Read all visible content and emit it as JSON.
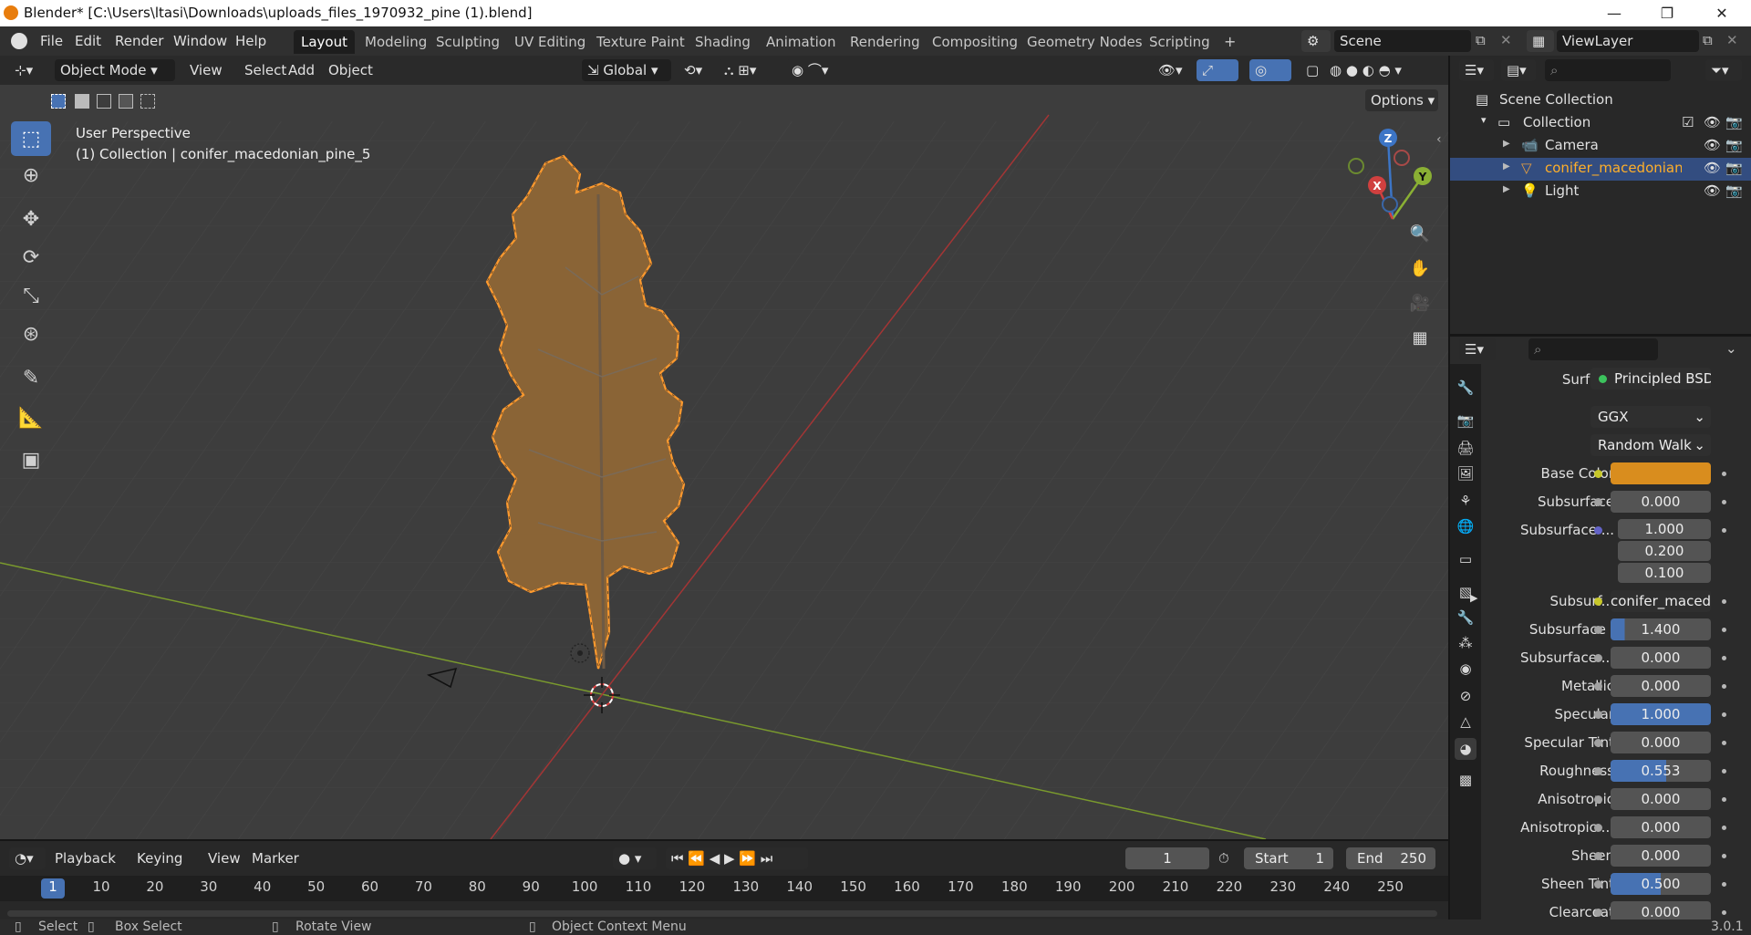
{
  "window": {
    "title": "Blender* [C:\\Users\\ltasi\\Downloads\\uploads_files_1970932_pine (1).blend]",
    "minimize": "—",
    "maximize": "❐",
    "close": "✕"
  },
  "menu": [
    "File",
    "Edit",
    "Render",
    "Window",
    "Help"
  ],
  "workspaces": [
    "Layout",
    "Modeling",
    "Sculpting",
    "UV Editing",
    "Texture Paint",
    "Shading",
    "Animation",
    "Rendering",
    "Compositing",
    "Geometry Nodes",
    "Scripting"
  ],
  "active_workspace": "Layout",
  "scene_name": "Scene",
  "view_layer": "ViewLayer",
  "viewport_header": {
    "mode": "Object Mode",
    "menus": [
      "View",
      "Select",
      "Add",
      "Object"
    ],
    "orientation": "Global",
    "options_label": "Options"
  },
  "viewport": {
    "perspective_label": "User Perspective",
    "collection_label": "(1) Collection | conifer_macedonian_pine_5",
    "gizmo": {
      "x": "X",
      "y": "Y",
      "z": "Z"
    }
  },
  "outliner": {
    "root": "Scene Collection",
    "collection": "Collection",
    "items": [
      {
        "name": "Camera",
        "selected": false
      },
      {
        "name": "conifer_macedonian_p",
        "selected": true
      },
      {
        "name": "Light",
        "selected": false
      }
    ]
  },
  "properties": {
    "surface_label": "Surface",
    "surface_value": "Principled BSDF",
    "distribution": "GGX",
    "subsurface_method": "Random Walk",
    "rows": [
      {
        "label": "Base Color",
        "value": "",
        "socket": "#c7c729",
        "kind": "color",
        "color": "#d98d1e"
      },
      {
        "label": "Subsurface",
        "value": "0.000",
        "socket": "#a1a1a1",
        "kind": "num",
        "fill": 0
      },
      {
        "label": "Subsurface ...",
        "value": "1.000",
        "socket": "#6363c7",
        "kind": "vec"
      },
      {
        "label": "",
        "value": "0.200",
        "socket": "",
        "kind": "vec2"
      },
      {
        "label": "",
        "value": "0.100",
        "socket": "",
        "kind": "vec2"
      },
      {
        "label": "Subsurf...",
        "value": "conifer_maced...",
        "socket": "#c7c729",
        "kind": "link"
      },
      {
        "label": "Subsurface I",
        "value": "1.400",
        "socket": "#a1a1a1",
        "kind": "num",
        "fill": 0.14
      },
      {
        "label": "Subsurface ...",
        "value": "0.000",
        "socket": "#a1a1a1",
        "kind": "num",
        "fill": 0
      },
      {
        "label": "Metallic",
        "value": "0.000",
        "socket": "#a1a1a1",
        "kind": "num",
        "fill": 0
      },
      {
        "label": "Specular",
        "value": "1.000",
        "socket": "#a1a1a1",
        "kind": "num",
        "fill": 1
      },
      {
        "label": "Specular Tint",
        "value": "0.000",
        "socket": "#a1a1a1",
        "kind": "num",
        "fill": 0
      },
      {
        "label": "Roughness",
        "value": "0.553",
        "socket": "#a1a1a1",
        "kind": "num",
        "fill": 0.553
      },
      {
        "label": "Anisotropic",
        "value": "0.000",
        "socket": "#a1a1a1",
        "kind": "num",
        "fill": 0
      },
      {
        "label": "Anisotropic ...",
        "value": "0.000",
        "socket": "#a1a1a1",
        "kind": "num",
        "fill": 0
      },
      {
        "label": "Sheen",
        "value": "0.000",
        "socket": "#a1a1a1",
        "kind": "num",
        "fill": 0
      },
      {
        "label": "Sheen Tint",
        "value": "0.500",
        "socket": "#a1a1a1",
        "kind": "num",
        "fill": 0.5
      },
      {
        "label": "Clearcoat",
        "value": "0.000",
        "socket": "#a1a1a1",
        "kind": "num",
        "fill": 0
      }
    ]
  },
  "timeline": {
    "menus": [
      "Playback",
      "Keying",
      "View",
      "Marker"
    ],
    "current_frame": "1",
    "start_label": "Start",
    "start": "1",
    "end_label": "End",
    "end": "250",
    "ticks": [
      "1",
      "10",
      "20",
      "30",
      "40",
      "50",
      "60",
      "70",
      "80",
      "90",
      "100",
      "110",
      "120",
      "130",
      "140",
      "150",
      "160",
      "170",
      "180",
      "190",
      "200",
      "210",
      "220",
      "230",
      "240",
      "250"
    ]
  },
  "status": {
    "select": "Select",
    "box_select": "Box Select",
    "rotate_view": "Rotate View",
    "context_menu": "Object Context Menu",
    "version": "3.0.1"
  },
  "colors": {
    "accent": "#4772b3",
    "selection": "#e87d0d",
    "header": "#303030"
  }
}
